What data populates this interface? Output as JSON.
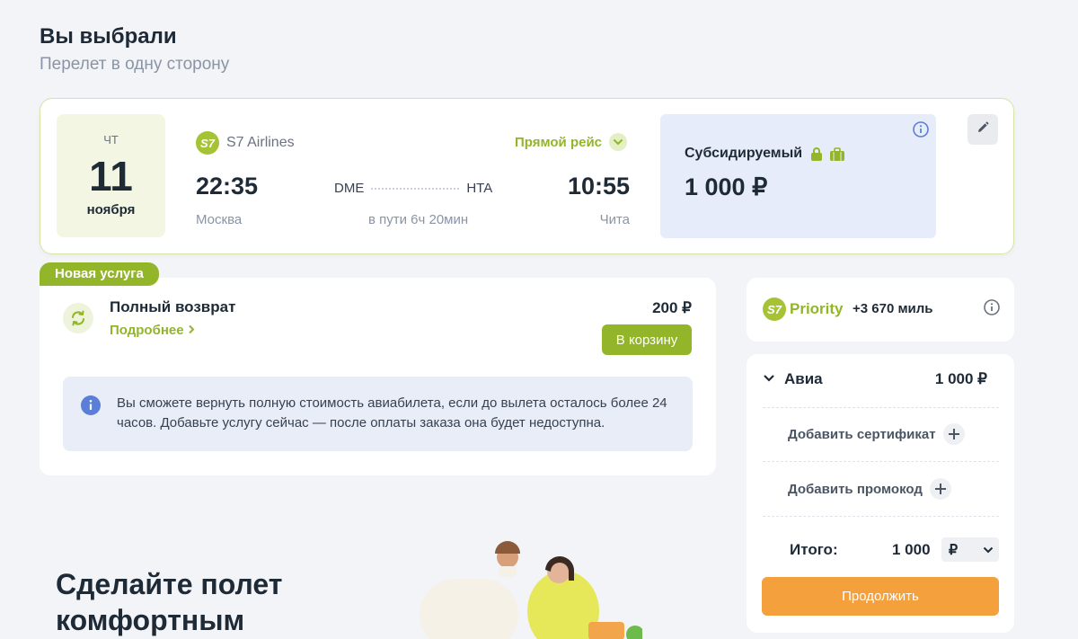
{
  "header": {
    "title": "Вы выбрали",
    "subtitle": "Перелет в одну сторону"
  },
  "flight": {
    "day_of_week": "ЧТ",
    "day": "11",
    "month": "ноября",
    "airline_logo": "S7",
    "airline": "S7 Airlines",
    "flight_type": "Прямой рейс",
    "departure_time": "22:35",
    "departure_city": "Москва",
    "departure_code": "DME",
    "arrival_time": "10:55",
    "arrival_city": "Чита",
    "arrival_code": "HTA",
    "duration": "в пути 6ч 20мин",
    "fare_name": "Субсидируемый",
    "fare_price": "1 000 ₽"
  },
  "service": {
    "badge": "Новая услуга",
    "title": "Полный возврат",
    "more": "Подробнее",
    "price": "200 ₽",
    "cart_button": "В корзину",
    "notice": "Вы сможете вернуть полную стоимость авиабилета, если до вылета осталось более 24 часов. Добавьте услугу сейчас — после оплаты заказа она будет недоступна."
  },
  "priority": {
    "logo_text": "S7",
    "brand": "Priority",
    "miles": "+3 670 миль"
  },
  "summary": {
    "avia_label": "Авиа",
    "avia_price": "1 000 ₽",
    "add_certificate": "Добавить сертификат",
    "add_promocode": "Добавить промокод",
    "total_label": "Итого:",
    "total_value": "1 000",
    "currency": "₽",
    "continue_button": "Продолжить"
  },
  "promo": {
    "title": "Сделайте полет комфортным"
  },
  "colors": {
    "accent_green": "#93b52a",
    "accent_orange": "#f4a03c",
    "info_blue": "#5b7fd6"
  }
}
